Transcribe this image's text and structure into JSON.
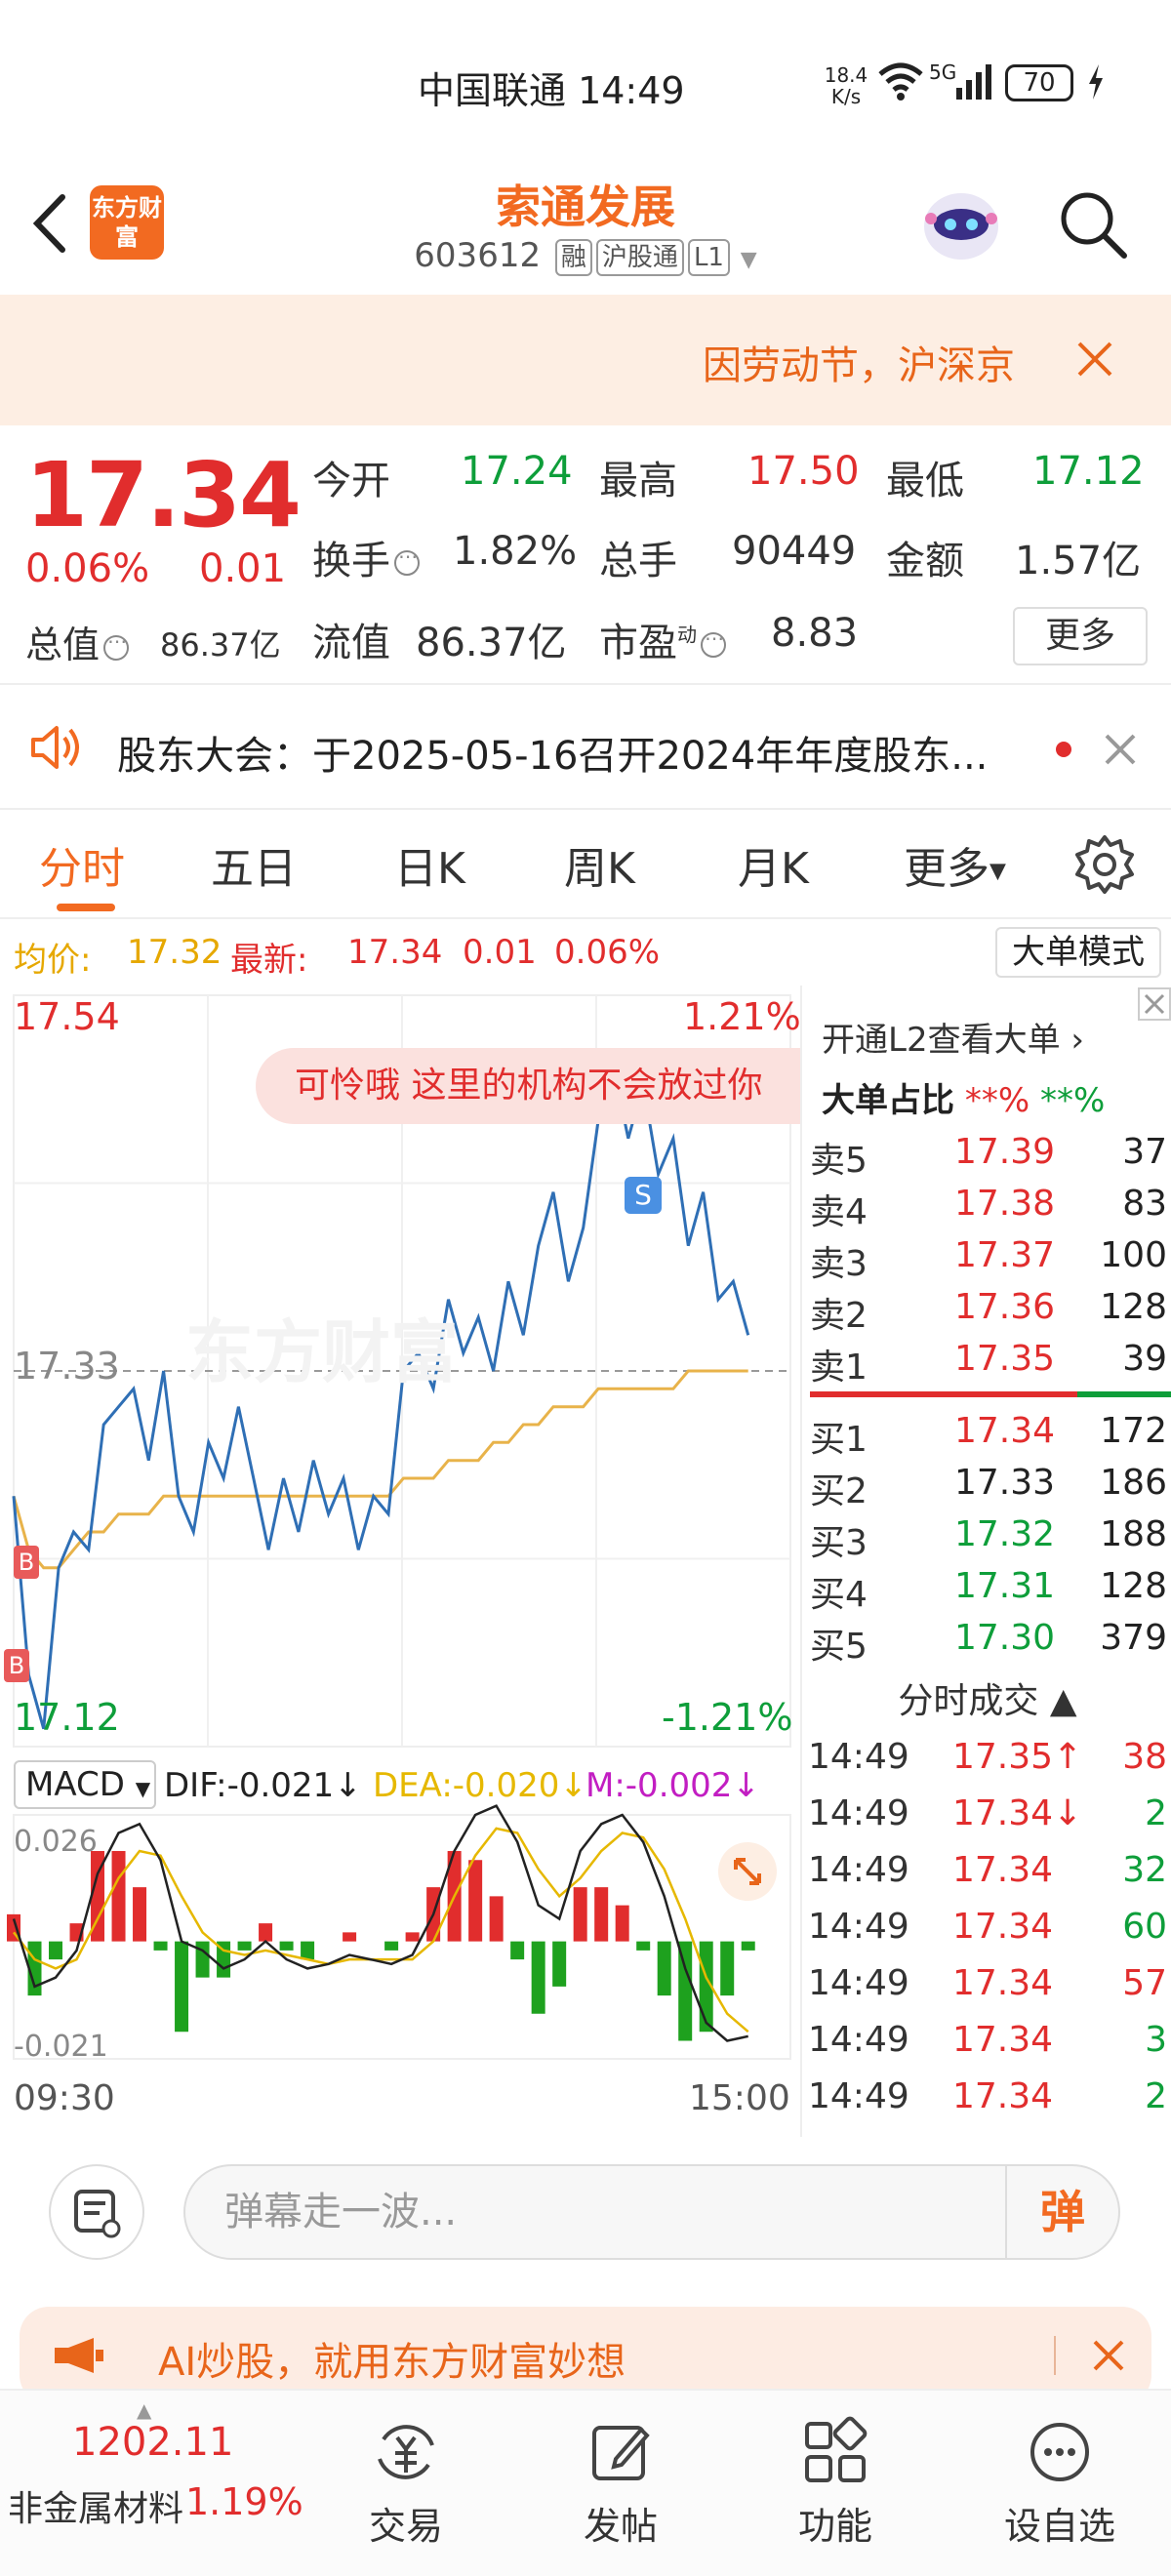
{
  "status": {
    "carrier_time": "中国联通 14:49",
    "net_speed_top": "18.4",
    "net_speed_unit": "K/s",
    "signal": "5G",
    "battery": "70"
  },
  "header": {
    "logo": "东方财富",
    "name": "索通发展",
    "code": "603612",
    "tags": [
      "融",
      "沪股通",
      "L1"
    ]
  },
  "banner": {
    "text": "因劳动节，沪深京"
  },
  "quote": {
    "price": "17.34",
    "pct": "0.06%",
    "chg": "0.01",
    "fields": [
      {
        "label": "今开",
        "value": "17.24",
        "color": "green"
      },
      {
        "label": "最高",
        "value": "17.50",
        "color": "red"
      },
      {
        "label": "最低",
        "value": "17.12",
        "color": "green"
      },
      {
        "label": "换手",
        "value": "1.82%",
        "color": "dark"
      },
      {
        "label": "总手",
        "value": "90449",
        "color": "dark"
      },
      {
        "label": "金额",
        "value": "1.57亿",
        "color": "dark"
      },
      {
        "label": "流值",
        "value": "86.37亿",
        "color": "dark"
      },
      {
        "label": "市盈",
        "value": "8.83",
        "color": "dark"
      }
    ],
    "zongzhi_label": "总值",
    "zongzhi_value": "86.37亿",
    "pe_sup": "动",
    "more": "更多"
  },
  "notice": {
    "text": "股东大会：于2025-05-16召开2024年年度股东..."
  },
  "tabs": [
    "分时",
    "五日",
    "日K",
    "周K",
    "月K",
    "更多"
  ],
  "avg": {
    "label": "均价:",
    "avg": "17.32",
    "latest_label": "最新:",
    "latest": "17.34",
    "chg": "0.01",
    "pct": "0.06%"
  },
  "bigorder_mode": "大单模式",
  "chart": {
    "max_price": "17.54",
    "max_pct": "1.21%",
    "min_price": "17.12",
    "min_pct": "-1.21%",
    "pre_close": "17.33",
    "watermark": "东方财富",
    "danmu": "可怜哦 这里的机构不会放过你",
    "markers": {
      "b": "B",
      "s": "S"
    },
    "time_start": "09:30",
    "time_end": "15:00",
    "macd": {
      "name": "MACD",
      "dif": "DIF:-0.021",
      "dea": "DEA:-0.020",
      "m": "M:-0.002",
      "top": "0.026",
      "bottom": "-0.021"
    }
  },
  "chart_data": {
    "type": "line",
    "title": "",
    "series": [
      {
        "values": [
          17.26,
          17.16,
          17.13,
          17.22,
          17.24,
          17.23,
          17.3,
          17.31,
          17.32,
          17.28,
          17.33,
          17.26,
          17.24,
          17.29,
          17.27,
          17.31,
          17.27,
          17.23,
          17.27,
          17.24,
          17.28,
          17.25,
          17.27,
          17.23,
          17.26,
          17.25,
          17.33,
          17.34,
          17.32,
          17.37,
          17.34,
          17.36,
          17.33,
          17.38,
          17.35,
          17.4,
          17.43,
          17.38,
          17.41,
          17.47,
          17.5,
          17.46,
          17.49,
          17.44,
          17.46,
          17.4,
          17.43,
          17.37,
          17.38,
          17.35
        ]
      },
      {
        "values": [
          17.26,
          17.23,
          17.22,
          17.22,
          17.23,
          17.24,
          17.24,
          17.25,
          17.25,
          17.25,
          17.26,
          17.26,
          17.26,
          17.26,
          17.26,
          17.26,
          17.26,
          17.26,
          17.26,
          17.26,
          17.26,
          17.26,
          17.26,
          17.26,
          17.26,
          17.26,
          17.27,
          17.27,
          17.27,
          17.28,
          17.28,
          17.28,
          17.29,
          17.29,
          17.3,
          17.3,
          17.31,
          17.31,
          17.31,
          17.32,
          17.32,
          17.32,
          17.32,
          17.32,
          17.32,
          17.33,
          17.33,
          17.33,
          17.33,
          17.33
        ]
      }
    ],
    "ylim": [
      17.12,
      17.54
    ],
    "macd": {
      "dif": [
        0.005,
        -0.01,
        -0.008,
        -0.002,
        0.015,
        0.024,
        0.026,
        0.018,
        0.0,
        -0.002,
        -0.006,
        -0.004,
        0.0,
        -0.004,
        -0.006,
        -0.005,
        -0.003,
        -0.004,
        -0.005,
        -0.003,
        0.006,
        0.02,
        0.028,
        0.03,
        0.022,
        0.008,
        0.005,
        0.02,
        0.026,
        0.028,
        0.022,
        0.01,
        -0.006,
        -0.018,
        -0.022,
        -0.021
      ],
      "dea": [
        0.002,
        -0.004,
        -0.006,
        -0.004,
        0.005,
        0.014,
        0.02,
        0.019,
        0.01,
        0.002,
        -0.002,
        -0.003,
        -0.002,
        -0.003,
        -0.004,
        -0.005,
        -0.004,
        -0.004,
        -0.004,
        -0.004,
        0.0,
        0.01,
        0.019,
        0.025,
        0.024,
        0.016,
        0.01,
        0.014,
        0.02,
        0.024,
        0.023,
        0.016,
        0.005,
        -0.008,
        -0.016,
        -0.02
      ],
      "hist": [
        0.006,
        -0.012,
        -0.004,
        0.004,
        0.02,
        0.02,
        0.012,
        -0.002,
        -0.02,
        -0.008,
        -0.008,
        -0.002,
        0.004,
        -0.002,
        -0.004,
        0.0,
        0.002,
        0.0,
        -0.002,
        0.002,
        0.012,
        0.02,
        0.018,
        0.01,
        -0.004,
        -0.016,
        -0.01,
        0.012,
        0.012,
        0.008,
        -0.002,
        -0.012,
        -0.022,
        -0.02,
        -0.012,
        -0.002
      ]
    }
  },
  "book": {
    "l2": "开通L2查看大单",
    "ratio_label": "大单占比",
    "ratio_red": "**%",
    "ratio_green": "**%",
    "asks": [
      {
        "label": "卖5",
        "price": "17.39",
        "vol": "37",
        "color": "red"
      },
      {
        "label": "卖4",
        "price": "17.38",
        "vol": "83",
        "color": "red"
      },
      {
        "label": "卖3",
        "price": "17.37",
        "vol": "100",
        "color": "red"
      },
      {
        "label": "卖2",
        "price": "17.36",
        "vol": "128",
        "color": "red"
      },
      {
        "label": "卖1",
        "price": "17.35",
        "vol": "39",
        "color": "red"
      }
    ],
    "bids": [
      {
        "label": "买1",
        "price": "17.34",
        "vol": "172",
        "color": "red"
      },
      {
        "label": "买2",
        "price": "17.33",
        "vol": "186",
        "color": "dark"
      },
      {
        "label": "买3",
        "price": "17.32",
        "vol": "188",
        "color": "green"
      },
      {
        "label": "买4",
        "price": "17.31",
        "vol": "128",
        "color": "green"
      },
      {
        "label": "买5",
        "price": "17.30",
        "vol": "379",
        "color": "green"
      }
    ],
    "ticks_title": "分时成交",
    "ticks": [
      {
        "time": "14:49",
        "price": "17.35↑",
        "vol": "38",
        "vcolor": "red"
      },
      {
        "time": "14:49",
        "price": "17.34↓",
        "vol": "2",
        "vcolor": "green"
      },
      {
        "time": "14:49",
        "price": "17.34",
        "vol": "32",
        "vcolor": "green"
      },
      {
        "time": "14:49",
        "price": "17.34",
        "vol": "60",
        "vcolor": "green"
      },
      {
        "time": "14:49",
        "price": "17.34",
        "vol": "57",
        "vcolor": "red"
      },
      {
        "time": "14:49",
        "price": "17.34",
        "vol": "3",
        "vcolor": "green"
      },
      {
        "time": "14:49",
        "price": "17.34",
        "vol": "2",
        "vcolor": "green"
      }
    ]
  },
  "input": {
    "placeholder": "弹幕走一波...",
    "send": "弹"
  },
  "ai_banner": {
    "text": "AI炒股，就用东方财富妙想"
  },
  "bottom": {
    "index_value": "1202.11",
    "index_name": "非金属材料",
    "index_pct": "1.19%",
    "items": [
      "交易",
      "发帖",
      "功能",
      "设自选"
    ]
  }
}
